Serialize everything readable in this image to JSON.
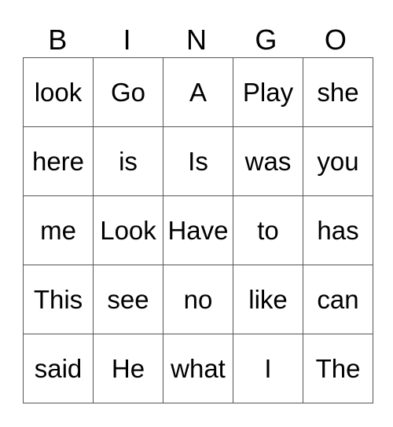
{
  "header": [
    "B",
    "I",
    "N",
    "G",
    "O"
  ],
  "rows": [
    [
      "look",
      "Go",
      "A",
      "Play",
      "she"
    ],
    [
      "here",
      "is",
      "Is",
      "was",
      "you"
    ],
    [
      "me",
      "Look",
      "Have",
      "to",
      "has"
    ],
    [
      "This",
      "see",
      "no",
      "like",
      "can"
    ],
    [
      "said",
      "He",
      "what",
      "I",
      "The"
    ]
  ]
}
